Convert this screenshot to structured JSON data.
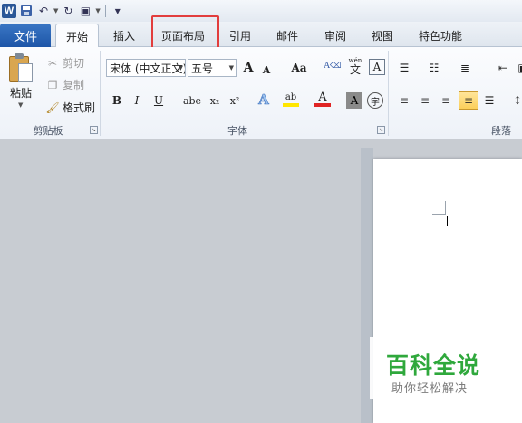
{
  "app_colors": {
    "accent": "#2b5797",
    "file_tab": "#1e56a8",
    "highlight": "#e23d3d",
    "watermark_green": "#2fa83c"
  },
  "quick_access": {
    "logo": "W",
    "icons": [
      "save-icon",
      "undo-icon",
      "redo-icon",
      "customize-icon"
    ]
  },
  "tabs": {
    "file": "文件",
    "items": [
      "开始",
      "插入",
      "页面布局",
      "引用",
      "邮件",
      "审阅",
      "视图",
      "特色功能"
    ],
    "active": "开始",
    "highlighted": "页面布局"
  },
  "clipboard": {
    "paste": "粘贴",
    "cut": "剪切",
    "copy": "复制",
    "format_painter": "格式刷",
    "group_label": "剪贴板"
  },
  "font": {
    "font_name": "宋体 (中文正文)",
    "font_size": "五号",
    "grow": "A",
    "shrink": "A",
    "change_case": "Aa",
    "bold": "B",
    "italic": "I",
    "underline": "U",
    "strike": "abe",
    "subscript": "x₂",
    "superscript": "x²",
    "text_effect": "A",
    "highlight": "ab",
    "font_color": "A",
    "char_shading": "A",
    "enclose": "字",
    "phonetic": "wén",
    "phonetic_char": "文",
    "char_border": "A",
    "group_label": "字体"
  },
  "paragraph": {
    "group_label": "段落"
  },
  "watermark": {
    "title": "百科全说",
    "subtitle": "助你轻松解决"
  }
}
